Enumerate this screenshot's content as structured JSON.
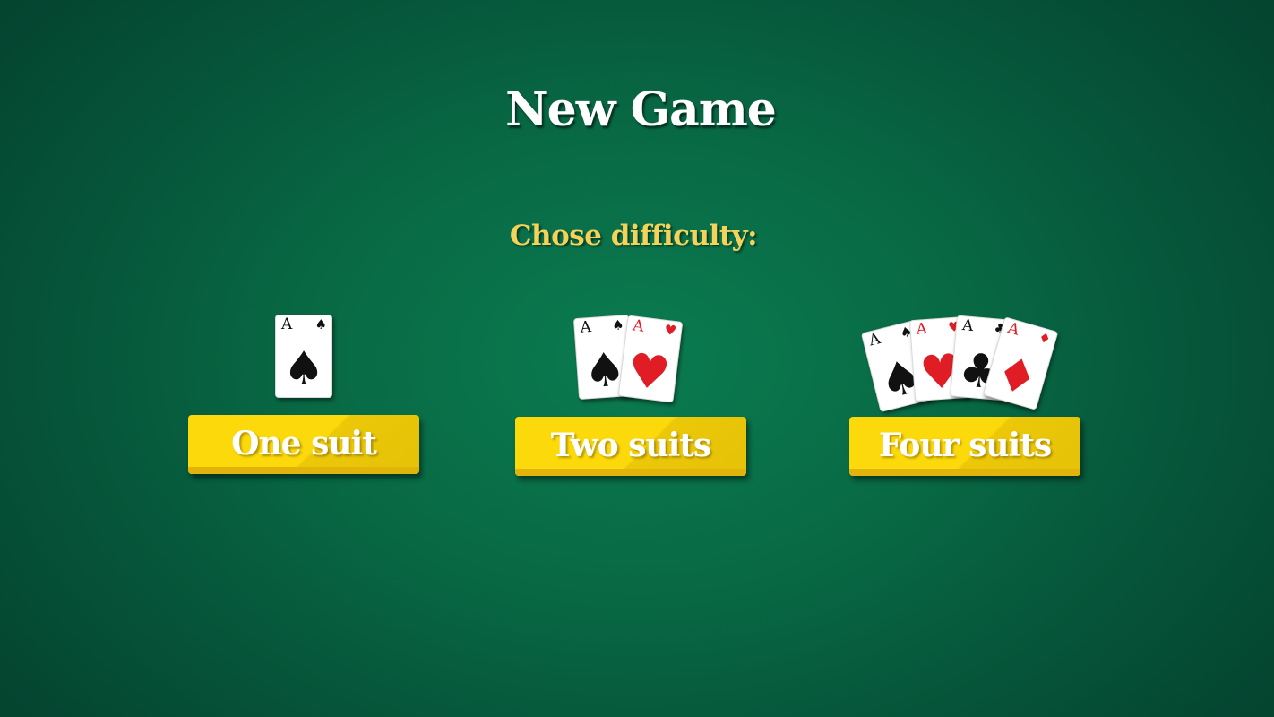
{
  "screen": {
    "title": "New Game",
    "subtitle": "Chose difficulty:"
  },
  "colors": {
    "background": "#0b7b50",
    "button": "#fcd90a",
    "subtitle": "#f3d35a",
    "card_red": "#e01c24",
    "card_black": "#111111"
  },
  "options": [
    {
      "label": "One suit",
      "cards": [
        {
          "rank": "A",
          "suit": "♠",
          "color": "black",
          "suit_name": "spade"
        }
      ]
    },
    {
      "label": "Two suits",
      "cards": [
        {
          "rank": "A",
          "suit": "♠",
          "color": "black",
          "suit_name": "spade"
        },
        {
          "rank": "A",
          "suit": "♥",
          "color": "red",
          "suit_name": "heart"
        }
      ]
    },
    {
      "label": "Four suits",
      "cards": [
        {
          "rank": "A",
          "suit": "♠",
          "color": "black",
          "suit_name": "spade"
        },
        {
          "rank": "A",
          "suit": "♥",
          "color": "red",
          "suit_name": "heart"
        },
        {
          "rank": "A",
          "suit": "♣",
          "color": "black",
          "suit_name": "club"
        },
        {
          "rank": "A",
          "suit": "♦",
          "color": "red",
          "suit_name": "diamond"
        }
      ]
    }
  ]
}
